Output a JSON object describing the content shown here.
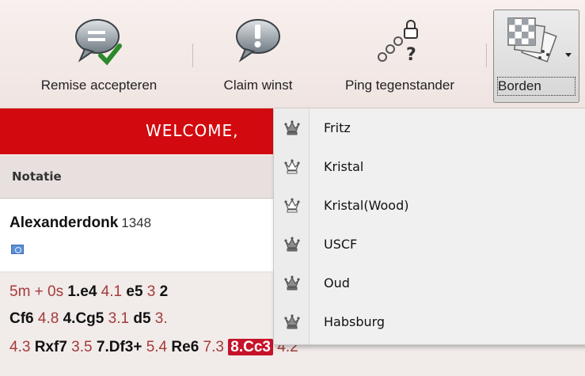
{
  "toolbar": {
    "accept_draw": "Remise accepteren",
    "claim_win": "Claim winst",
    "ping_opponent": "Ping tegenstander",
    "boards": "Borden"
  },
  "welcome": {
    "text": "WELCOME,"
  },
  "notation": {
    "header": "Notatie"
  },
  "player": {
    "name": "Alexanderdonk",
    "rating": "1348"
  },
  "moves": {
    "line1": [
      {
        "k": "t",
        "v": "5m + 0s "
      },
      {
        "k": "m",
        "v": "1.e4"
      },
      {
        "k": "t",
        "v": " 4.1 "
      },
      {
        "k": "m",
        "v": "e5"
      },
      {
        "k": "t",
        "v": " 3 "
      },
      {
        "k": "m",
        "v": "2"
      }
    ],
    "line2": [
      {
        "k": "m",
        "v": "Cf6"
      },
      {
        "k": "t",
        "v": " 4.8 "
      },
      {
        "k": "m",
        "v": "4.Cg5"
      },
      {
        "k": "t",
        "v": " 3.1 "
      },
      {
        "k": "m",
        "v": "d5"
      },
      {
        "k": "t",
        "v": " 3."
      }
    ],
    "line3": [
      {
        "k": "t",
        "v": "4.3 "
      },
      {
        "k": "m",
        "v": "Rxf7"
      },
      {
        "k": "t",
        "v": " 3.5 "
      },
      {
        "k": "m",
        "v": "7.Df3+"
      },
      {
        "k": "t",
        "v": " 5.4 "
      },
      {
        "k": "m",
        "v": "Re6"
      },
      {
        "k": "t",
        "v": " 7.3 "
      },
      {
        "k": "hl",
        "v": "8.Cc3"
      },
      {
        "k": "t",
        "v": " 4.2"
      }
    ]
  },
  "board_menu": {
    "items": [
      {
        "label": "Fritz",
        "icon": "queen-icon"
      },
      {
        "label": "Kristal",
        "icon": "queen-outline-icon"
      },
      {
        "label": "Kristal(Wood)",
        "icon": "queen-outline-icon"
      },
      {
        "label": "USCF",
        "icon": "queen-icon"
      },
      {
        "label": "Oud",
        "icon": "queen-icon"
      },
      {
        "label": "Habsburg",
        "icon": "queen-icon"
      }
    ]
  },
  "colors": {
    "welcome_bg": "#d20a10",
    "move_time": "#a33b3b",
    "highlight_move": "#c6132a",
    "toolbar_bg": "#f5ecea"
  }
}
